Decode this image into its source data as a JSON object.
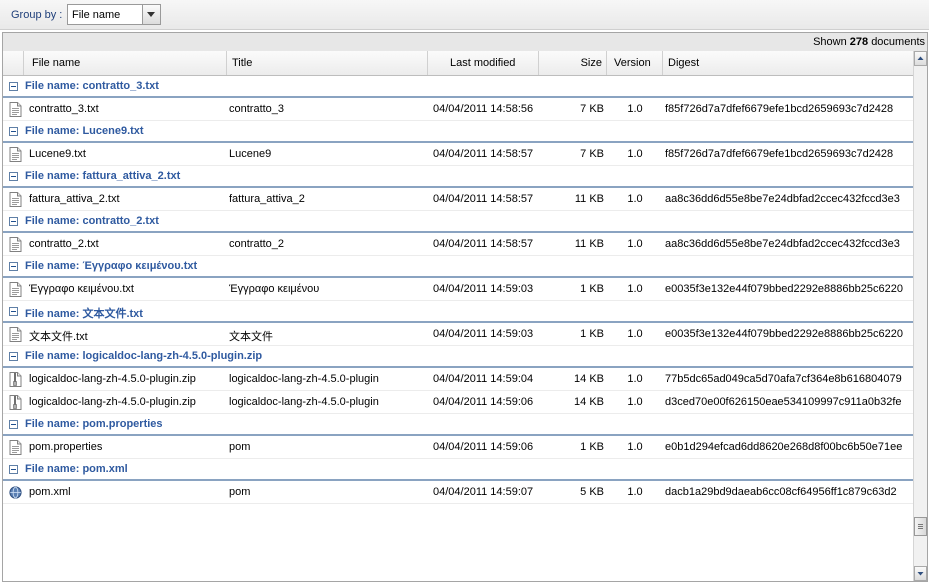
{
  "toolbar": {
    "group_by_label": "Group by :",
    "group_by_value": "File name"
  },
  "grid": {
    "shown_prefix": "Shown",
    "shown_count": "278",
    "shown_suffix": "documents",
    "columns": {
      "file_name": "File name",
      "title": "Title",
      "last_modified": "Last modified",
      "size": "Size",
      "version": "Version",
      "digest": "Digest"
    },
    "groups": [
      {
        "label": "File name: contratto_3.txt",
        "rows": [
          {
            "icon": "text-file-icon",
            "name": "contratto_3.txt",
            "title": "contratto_3",
            "modified": "04/04/2011 14:58:56",
            "size": "7 KB",
            "version": "1.0",
            "digest": "f85f726d7a7dfef6679efe1bcd2659693c7d2428"
          }
        ]
      },
      {
        "label": "File name: Lucene9.txt",
        "rows": [
          {
            "icon": "text-file-icon",
            "name": "Lucene9.txt",
            "title": "Lucene9",
            "modified": "04/04/2011 14:58:57",
            "size": "7 KB",
            "version": "1.0",
            "digest": "f85f726d7a7dfef6679efe1bcd2659693c7d2428"
          }
        ]
      },
      {
        "label": "File name: fattura_attiva_2.txt",
        "rows": [
          {
            "icon": "text-file-icon",
            "name": "fattura_attiva_2.txt",
            "title": "fattura_attiva_2",
            "modified": "04/04/2011 14:58:57",
            "size": "11 KB",
            "version": "1.0",
            "digest": "aa8c36dd6d55e8be7e24dbfad2ccec432fccd3e3"
          }
        ]
      },
      {
        "label": "File name: contratto_2.txt",
        "rows": [
          {
            "icon": "text-file-icon",
            "name": "contratto_2.txt",
            "title": "contratto_2",
            "modified": "04/04/2011 14:58:57",
            "size": "11 KB",
            "version": "1.0",
            "digest": "aa8c36dd6d55e8be7e24dbfad2ccec432fccd3e3"
          }
        ]
      },
      {
        "label": "File name: Έγγραφο κειμένου.txt",
        "rows": [
          {
            "icon": "text-file-icon",
            "name": "Έγγραφο κειμένου.txt",
            "title": "Έγγραφο κειμένου",
            "modified": "04/04/2011 14:59:03",
            "size": "1 KB",
            "version": "1.0",
            "digest": "e0035f3e132e44f079bbed2292e8886bb25c6220"
          }
        ]
      },
      {
        "label": "File name: 文本文件.txt",
        "rows": [
          {
            "icon": "text-file-icon",
            "name": "文本文件.txt",
            "title": "文本文件",
            "modified": "04/04/2011 14:59:03",
            "size": "1 KB",
            "version": "1.0",
            "digest": "e0035f3e132e44f079bbed2292e8886bb25c6220"
          }
        ]
      },
      {
        "label": "File name: logicaldoc-lang-zh-4.5.0-plugin.zip",
        "rows": [
          {
            "icon": "zip-file-icon",
            "name": "logicaldoc-lang-zh-4.5.0-plugin.zip",
            "title": "logicaldoc-lang-zh-4.5.0-plugin",
            "modified": "04/04/2011 14:59:04",
            "size": "14 KB",
            "version": "1.0",
            "digest": "77b5dc65ad049ca5d70afa7cf364e8b616804079"
          },
          {
            "icon": "zip-file-icon",
            "name": "logicaldoc-lang-zh-4.5.0-plugin.zip",
            "title": "logicaldoc-lang-zh-4.5.0-plugin",
            "modified": "04/04/2011 14:59:06",
            "size": "14 KB",
            "version": "1.0",
            "digest": "d3ced70e00f626150eae534109997c911a0b32fe"
          }
        ]
      },
      {
        "label": "File name: pom.properties",
        "rows": [
          {
            "icon": "text-file-icon",
            "name": "pom.properties",
            "title": "pom",
            "modified": "04/04/2011 14:59:06",
            "size": "1 KB",
            "version": "1.0",
            "digest": "e0b1d294efcad6dd8620e268d8f00bc6b50e71ee"
          }
        ]
      },
      {
        "label": "File name: pom.xml",
        "rows": [
          {
            "icon": "xml-file-icon",
            "name": "pom.xml",
            "title": "pom",
            "modified": "04/04/2011 14:59:07",
            "size": "5 KB",
            "version": "1.0",
            "digest": "dacb1a29bd9daeab6cc08cf64956ff1c879c63d2"
          }
        ]
      }
    ]
  }
}
